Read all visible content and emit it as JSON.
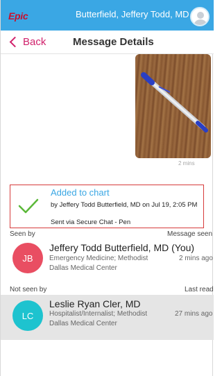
{
  "header": {
    "logo": "Epic",
    "user_name": "Butterfield, Jeffery Todd, MD"
  },
  "nav": {
    "back_label": "Back",
    "title": "Message Details"
  },
  "message": {
    "time": "2 mins"
  },
  "added_to_chart": {
    "title": "Added to chart",
    "by": "by Jeffery Todd Butterfield, MD on Jul 19, 2:05 PM",
    "sent": "Sent via Secure Chat - Pen"
  },
  "seen_section": {
    "label": "Seen by",
    "right_label": "Message seen",
    "people": [
      {
        "initials": "JB",
        "color": "#e94e62",
        "name": "Jeffery Todd Butterfield, MD (You)",
        "dept": "Emergency Medicine; Methodist",
        "org": "Dallas Medical Center",
        "time": "2 mins ago"
      }
    ]
  },
  "not_seen_section": {
    "label": "Not seen by",
    "right_label": "Last read",
    "people": [
      {
        "initials": "LC",
        "color": "#1ec3cf",
        "name": "Leslie Ryan Cler, MD",
        "dept": "Hospitalist/Internalist; Methodist",
        "org": "Dallas Medical Center",
        "time": "27 mins ago"
      }
    ]
  },
  "colors": {
    "header": "#3aa7e4",
    "accent": "#d0216b",
    "highlight_border": "#d63a3a",
    "check": "#5bb839"
  }
}
